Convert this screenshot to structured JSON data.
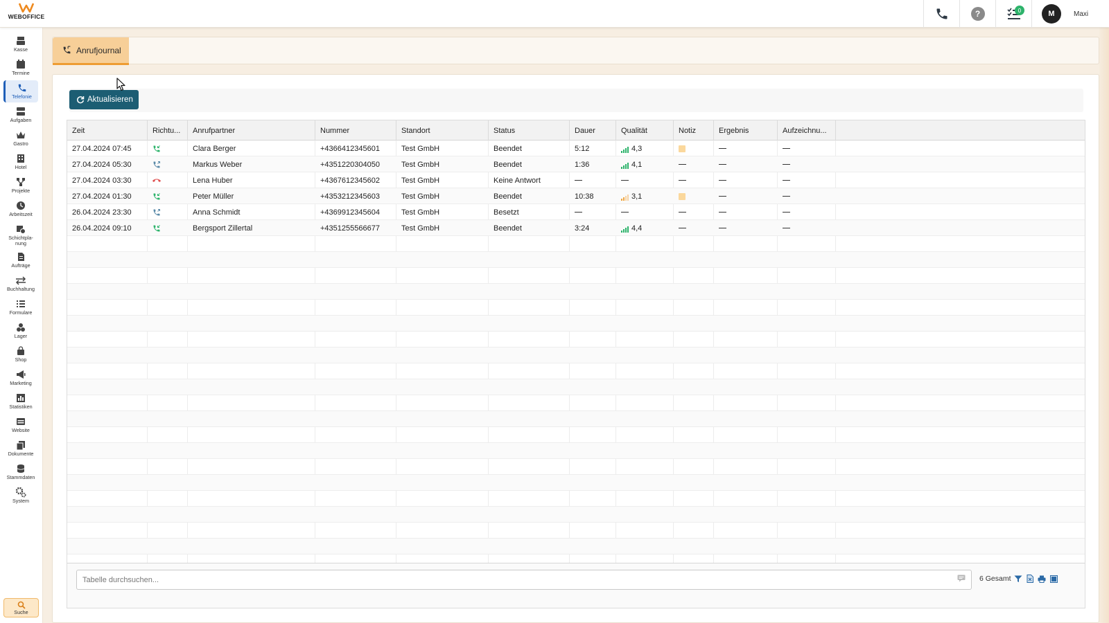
{
  "app": {
    "logo_text": "WEBOFFICE"
  },
  "topbar": {
    "tasks_badge": "0",
    "avatar_initial": "M",
    "user_name": "Maxi",
    "help_label": "?"
  },
  "sidebar": {
    "items": [
      {
        "label": "Kasse",
        "icon": "cash-register-icon"
      },
      {
        "label": "Termine",
        "icon": "calendar-icon"
      },
      {
        "label": "Telefonie",
        "icon": "phone-icon",
        "active": true
      },
      {
        "label": "Aufgaben",
        "icon": "tasks-icon"
      },
      {
        "label": "Gastro",
        "icon": "crown-icon"
      },
      {
        "label": "Hotel",
        "icon": "hotel-icon"
      },
      {
        "label": "Projekte",
        "icon": "projects-icon"
      },
      {
        "label": "Arbeitszeit",
        "icon": "clock-icon"
      },
      {
        "label": "Schichtpla-\nnung",
        "icon": "shift-plan-icon"
      },
      {
        "label": "Aufträge",
        "icon": "orders-icon"
      },
      {
        "label": "Buchhaltung",
        "icon": "arrows-icon"
      },
      {
        "label": "Formulare",
        "icon": "forms-icon"
      },
      {
        "label": "Lager",
        "icon": "boxes-icon"
      },
      {
        "label": "Shop",
        "icon": "shopping-bag-icon"
      },
      {
        "label": "Marketing",
        "icon": "megaphone-icon"
      },
      {
        "label": "Statistiken",
        "icon": "chart-icon"
      },
      {
        "label": "Website",
        "icon": "website-icon"
      },
      {
        "label": "Dokumente",
        "icon": "documents-icon"
      },
      {
        "label": "Stammdaten",
        "icon": "database-icon"
      },
      {
        "label": "System",
        "icon": "gears-icon"
      }
    ],
    "search_label": "Suche"
  },
  "tab": {
    "label": "Anrufjournal"
  },
  "toolbar": {
    "refresh_label": "Aktualisieren"
  },
  "table": {
    "columns": [
      "Zeit",
      "Richtu...",
      "Anrufpartner",
      "Nummer",
      "Standort",
      "Status",
      "Dauer",
      "Qualität",
      "Notiz",
      "Ergebnis",
      "Aufzeichnu..."
    ],
    "rows": [
      {
        "zeit": "27.04.2024 07:45",
        "direction": "incoming",
        "partner": "Clara Berger",
        "nummer": "+4366412345601",
        "standort": "Test GmbH",
        "status": "Beendet",
        "dauer": "5:12",
        "quality": "4,3",
        "quality_level": "good",
        "note": true
      },
      {
        "zeit": "27.04.2024 05:30",
        "direction": "outgoing",
        "partner": "Markus Weber",
        "nummer": "+4351220304050",
        "standort": "Test GmbH",
        "status": "Beendet",
        "dauer": "1:36",
        "quality": "4,1",
        "quality_level": "good",
        "note": false
      },
      {
        "zeit": "27.04.2024 03:30",
        "direction": "missed",
        "partner": "Lena Huber",
        "nummer": "+4367612345602",
        "standort": "Test GmbH",
        "status": "Keine Antwort",
        "dauer": null,
        "quality": null,
        "quality_level": null,
        "note": false
      },
      {
        "zeit": "27.04.2024 01:30",
        "direction": "incoming",
        "partner": "Peter Müller",
        "nummer": "+4353212345603",
        "standort": "Test GmbH",
        "status": "Beendet",
        "dauer": "10:38",
        "quality": "3,1",
        "quality_level": "medium",
        "note": true
      },
      {
        "zeit": "26.04.2024 23:30",
        "direction": "outgoing",
        "partner": "Anna Schmidt",
        "nummer": "+4369912345604",
        "standort": "Test GmbH",
        "status": "Besetzt",
        "dauer": null,
        "quality": null,
        "quality_level": null,
        "note": false
      },
      {
        "zeit": "26.04.2024 09:10",
        "direction": "incoming",
        "partner": "Bergsport Zillertal",
        "nummer": "+4351255566677",
        "standort": "Test GmbH",
        "status": "Beendet",
        "dauer": "3:24",
        "quality": "4,4",
        "quality_level": "good",
        "note": false
      }
    ]
  },
  "footer": {
    "search_placeholder": "Tabelle durchsuchen...",
    "total": "6 Gesamt"
  },
  "colors": {
    "accent_orange": "#f7cf98",
    "primary_button": "#1c5d73",
    "incoming": "#2db36b",
    "outgoing": "#5a8aa8",
    "missed": "#e05050",
    "quality_good": "#2db36b",
    "quality_medium": "#f0a640"
  }
}
